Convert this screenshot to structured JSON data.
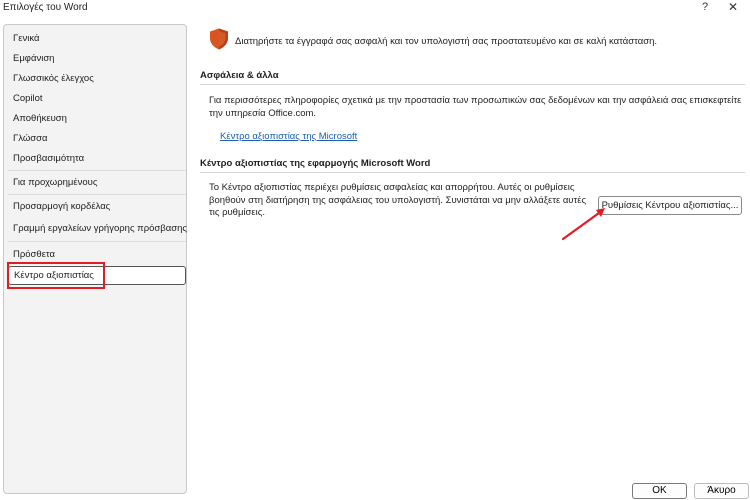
{
  "window": {
    "title": "Επιλογές του Word",
    "help_label": "?",
    "close_label": "✕"
  },
  "sidebar": {
    "items": [
      {
        "label": "Γενικά",
        "selected": false
      },
      {
        "label": "Εμφάνιση",
        "selected": false
      },
      {
        "label": "Γλωσσικός έλεγχος",
        "selected": false
      },
      {
        "label": "Copilot",
        "selected": false
      },
      {
        "label": "Αποθήκευση",
        "selected": false
      },
      {
        "label": "Γλώσσα",
        "selected": false
      },
      {
        "label": "Προσβασιμότητα",
        "selected": false
      },
      {
        "label": "Για προχωρημένους",
        "selected": false
      },
      {
        "label": "Προσαρμογή κορδέλας",
        "selected": false
      },
      {
        "label": "Γραμμή εργαλείων γρήγορης πρόσβασης",
        "selected": false
      },
      {
        "label": "Πρόσθετα",
        "selected": false
      },
      {
        "label": "Κέντρο αξιοπιστίας",
        "selected": true
      }
    ]
  },
  "main": {
    "header_text": "Διατηρήστε τα έγγραφά σας ασφαλή και τον υπολογιστή σας προστατευμένο και σε καλή κατάσταση.",
    "security_section": {
      "title": "Ασφάλεια & άλλα",
      "description_line1": "Για περισσότερες πληροφορίες σχετικά με την προστασία των προσωπικών σας δεδομένων και την ασφάλειά σας επισκεφτείτε",
      "description_line2": "την υπηρεσία Office.com.",
      "link_text": "Κέντρο αξιοπιστίας της Microsoft"
    },
    "trust_center_section": {
      "title": "Κέντρο αξιοπιστίας της εφαρμογής Microsoft Word",
      "description_line1": "Το Κέντρο αξιοπιστίας περιέχει ρυθμίσεις ασφαλείας και απορρήτου. Αυτές οι ρυθμίσεις",
      "description_line2": "βοηθούν στη διατήρηση της ασφάλειας του υπολογιστή. Συνιστάται να μην αλλάξετε αυτές",
      "description_line3": "τις ρυθμίσεις.",
      "button_label": "Ρυθμίσεις Κέντρου αξιοπιστίας..."
    }
  },
  "footer": {
    "ok_label": "OK",
    "cancel_label": "Άκυρο"
  },
  "colors": {
    "accent_link": "#1a5eb6",
    "highlight_red": "#e01c24",
    "shield_orange": "#d9541e"
  }
}
